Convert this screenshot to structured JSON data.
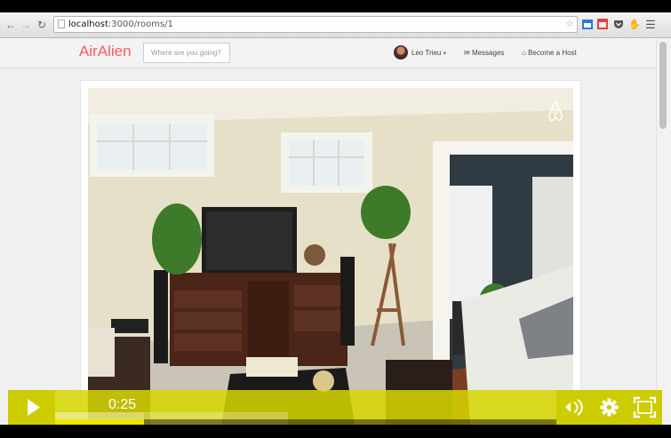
{
  "browser": {
    "url_host": "localhost",
    "url_path": ":3000/rooms/1",
    "icons": [
      "back-arrow-icon",
      "forward-arrow-icon",
      "reload-icon",
      "star-icon",
      "menu-icon"
    ]
  },
  "app": {
    "brand": "AirAlien",
    "search_placeholder": "Where are you going?",
    "user_name": "Leo Trieu",
    "user_caret": "▾",
    "messages_label": "Messages",
    "host_label": "Become a Host",
    "accent_color": "#ff5a5f"
  },
  "player": {
    "time": "0:25",
    "progress": 0.177,
    "buffered": 0.465,
    "bar_color": "#d6d600",
    "icons": [
      "play-icon",
      "volume-icon",
      "settings-gear-icon",
      "fullscreen-icon"
    ]
  },
  "media": {
    "watermark": "airbnb-logo"
  }
}
